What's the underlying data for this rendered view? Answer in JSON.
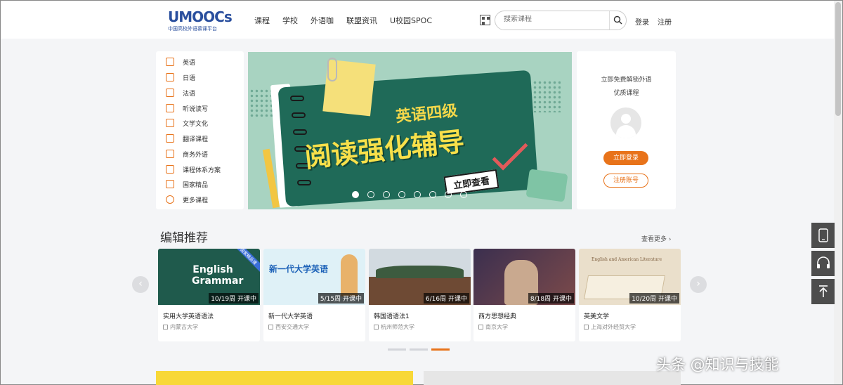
{
  "header": {
    "logo_text": "UMOOCs",
    "logo_subtitle": "中国高校外语慕课平台",
    "nav": [
      "课程",
      "学校",
      "外语咖",
      "联盟资讯",
      "U校园SPOC"
    ],
    "search_placeholder": "搜索课程",
    "login": "登录",
    "register": "注册"
  },
  "categories": [
    "英语",
    "日语",
    "法语",
    "听说读写",
    "文学文化",
    "翻译课程",
    "商务外语",
    "课程体系方案",
    "国家精品",
    "更多课程"
  ],
  "banner": {
    "subtitle": "英语四级",
    "title": "阅读强化辅导",
    "tag": "立即查看",
    "slide_count": 8,
    "active_slide": 1
  },
  "login_panel": {
    "line1": "立即免费解锁外语",
    "line2": "优质课程",
    "login_button": "立即登录",
    "register_button": "注册账号"
  },
  "section": {
    "title": "编辑推荐",
    "more": "查看更多 ›",
    "prev": "‹",
    "next": "›",
    "cards": [
      {
        "name": "实用大学英语语法",
        "school": "内蒙古大学",
        "badge": "10/19周 开课中",
        "img_text": "English Grammar",
        "corner": "国家精品课"
      },
      {
        "name": "新一代大学英语",
        "school": "西安交通大学",
        "badge": "5/15周 开课中",
        "img_text": "新一代大学英语",
        "corner": ""
      },
      {
        "name": "韩国语语法1",
        "school": "杭州师范大学",
        "badge": "6/16周 开课中",
        "img_text": "",
        "corner": ""
      },
      {
        "name": "西方思想经典",
        "school": "南京大学",
        "badge": "8/18周 开课中",
        "img_text": "",
        "corner": ""
      },
      {
        "name": "英美文学",
        "school": "上海对外经贸大学",
        "badge": "10/20周 开课中",
        "img_text": "English and American Literature",
        "corner": ""
      }
    ],
    "pager_count": 3,
    "pager_active": 3
  },
  "watermark": "头条 @知识与技能"
}
